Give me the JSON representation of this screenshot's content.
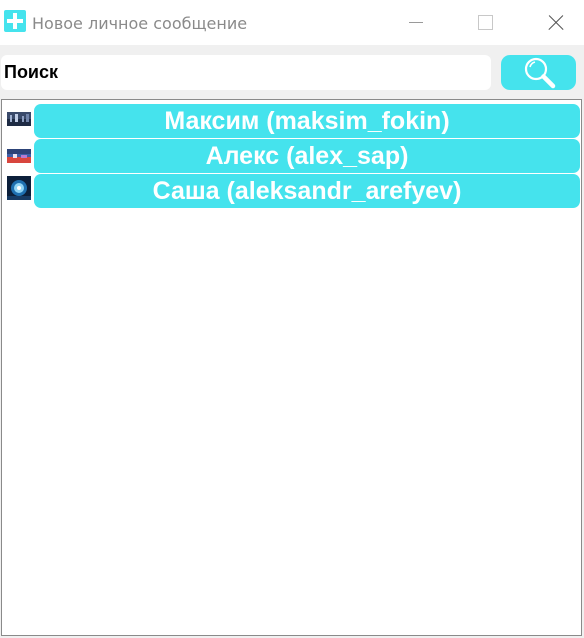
{
  "window": {
    "title": "Новое личное сообщение",
    "app_icon": "plus-icon",
    "controls": [
      "minimize-icon",
      "maximize-icon",
      "close-icon"
    ]
  },
  "search": {
    "placeholder": "Поиск",
    "value": "",
    "button_icon": "magnifier-icon"
  },
  "contacts": [
    {
      "label": "Максим (maksim_fokin)",
      "avatar": "avatar-image"
    },
    {
      "label": "Алекс (alex_sap)",
      "avatar": "avatar-image"
    },
    {
      "label": "Саша (aleksandr_arefyev)",
      "avatar": "avatar-image"
    }
  ],
  "colors": {
    "accent": "#45e3ed",
    "window_bg": "#f0f0f0",
    "panel_bg": "#ffffff",
    "contact_text": "#ffffff",
    "title_text": "#8a8a8a"
  }
}
